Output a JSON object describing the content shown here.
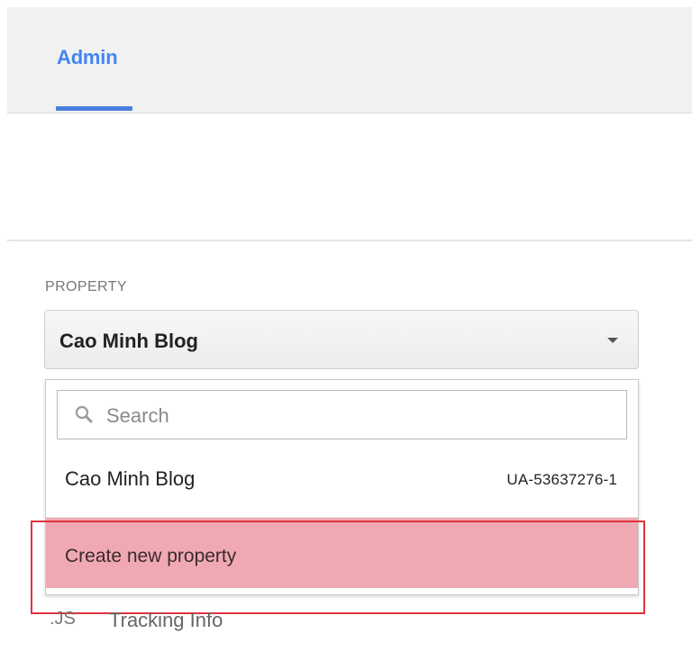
{
  "header": {
    "tab_label": "Admin",
    "accent_color": "#4285f4"
  },
  "property": {
    "section_label": "PROPERTY",
    "selected": "Cao Minh Blog",
    "search": {
      "placeholder": "Search",
      "value": ""
    },
    "items": [
      {
        "name": "Cao Minh Blog",
        "id": "UA-53637276-1"
      }
    ],
    "create_label": "Create new property",
    "highlight_color": "#e0323f"
  },
  "nav": {
    "tracking_icon": ".JS",
    "tracking_label": "Tracking Info"
  }
}
